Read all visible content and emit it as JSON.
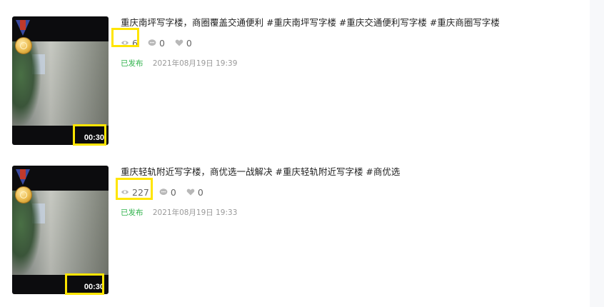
{
  "videos": [
    {
      "title": "重庆南坪写字楼，商圈覆盖交通便利 #重庆南坪写字楼 #重庆交通便利写字楼 #重庆商圈写字楼",
      "views": "6",
      "comments": "0",
      "likes": "0",
      "status": "已发布",
      "date": "2021年08月19日 19:39",
      "duration": "00:30"
    },
    {
      "title": "重庆轻轨附近写字楼，商优选一战解决 #重庆轻轨附近写字楼 #商优选",
      "views": "227",
      "comments": "0",
      "likes": "0",
      "status": "已发布",
      "date": "2021年08月19日 19:33",
      "duration": "00:30"
    }
  ],
  "colors": {
    "status_green": "#2eb24a",
    "highlight_yellow": "#ffe500",
    "muted_text": "#999999"
  },
  "icons": {
    "views": "eye-icon",
    "comments": "comment-bubble-icon",
    "likes": "heart-icon"
  }
}
